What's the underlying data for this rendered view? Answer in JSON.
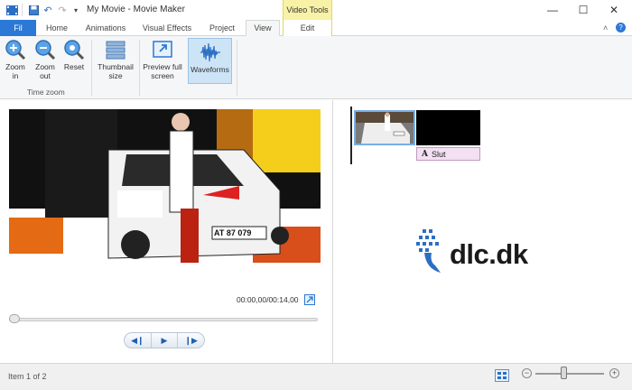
{
  "window": {
    "title": "My Movie - Movie Maker",
    "contextual_tab_group": "Video Tools",
    "minimize": "—",
    "maximize": "☐",
    "close": "✕"
  },
  "tabs": [
    {
      "label": "Fil"
    },
    {
      "label": "Home"
    },
    {
      "label": "Animations"
    },
    {
      "label": "Visual Effects"
    },
    {
      "label": "Project"
    },
    {
      "label": "View"
    },
    {
      "label": "Edit"
    }
  ],
  "ribbon": {
    "zoom_in": "Zoom in",
    "zoom_out": "Zoom out",
    "reset": "Reset",
    "group_time_zoom": "Time zoom",
    "thumbnail_size": "Thumbnail size",
    "preview_full_screen": "Preview full screen",
    "waveforms": "Waveforms"
  },
  "preview": {
    "timecode": "00:00,00/00:14,00",
    "plate": "AT 87 079"
  },
  "storyboard": {
    "caption": "Slut",
    "caption_icon": "A",
    "logo_text": "dlc.dk"
  },
  "status": {
    "item_text": "Item 1 of 2",
    "zoom_minus": "−",
    "zoom_plus": "+"
  },
  "colors": {
    "file_tab": "#2b78d6",
    "contextual": "#f8f2a6",
    "selected_button": "#cde4f7",
    "caption_bg": "#f3e0f3",
    "logo_blue": "#2b6fc4"
  }
}
